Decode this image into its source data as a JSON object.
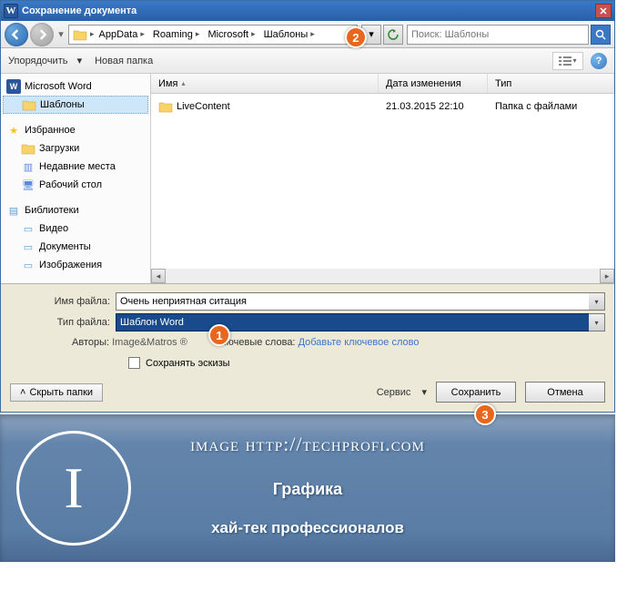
{
  "title": "Сохранение документа",
  "breadcrumb": [
    "AppData",
    "Roaming",
    "Microsoft",
    "Шаблоны"
  ],
  "search": {
    "placeholder": "Поиск: Шаблоны"
  },
  "toolbar": {
    "organize": "Упорядочить",
    "newfolder": "Новая папка"
  },
  "tree": {
    "word": "Microsoft Word",
    "templates": "Шаблоны",
    "favorites": "Избранное",
    "downloads": "Загрузки",
    "recent": "Недавние места",
    "desktop": "Рабочий стол",
    "libraries": "Библиотеки",
    "videos": "Видео",
    "documents": "Документы",
    "pictures": "Изображения"
  },
  "columns": {
    "name": "Имя",
    "date": "Дата изменения",
    "type": "Тип"
  },
  "rows": [
    {
      "name": "LiveContent",
      "date": "21.03.2015 22:10",
      "type": "Папка с файлами"
    }
  ],
  "form": {
    "fname_label": "Имя файла:",
    "fname_value": "Очень неприятная ситация",
    "ftype_label": "Тип файла:",
    "ftype_value": "Шаблон Word",
    "authors_label": "Авторы:",
    "authors_value": "Image&Matros ®",
    "keywords_label": "Ключевые слова:",
    "keywords_hint": "Добавьте ключевое слово",
    "save_thumb": "Сохранять эскизы",
    "hide": "Скрыть папки",
    "service": "Сервис",
    "save": "Сохранить",
    "cancel": "Отмена"
  },
  "badges": {
    "b1": "1",
    "b2": "2",
    "b3": "3"
  },
  "footer": {
    "url": "image http://techprofi.com",
    "t1": "Графика",
    "t2": "хай-тек профессионалов",
    "logo": "I"
  }
}
